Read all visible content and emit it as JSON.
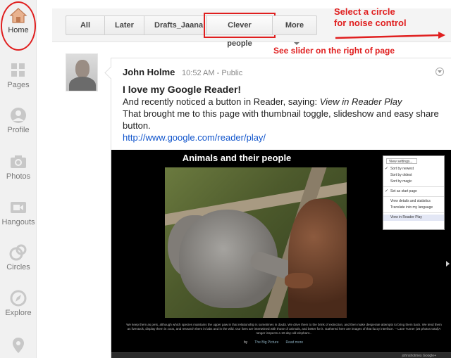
{
  "leftnav": {
    "items": [
      {
        "label": "Home",
        "icon": "home-icon"
      },
      {
        "label": "Pages",
        "icon": "pages-icon"
      },
      {
        "label": "Profile",
        "icon": "profile-icon"
      },
      {
        "label": "Photos",
        "icon": "camera-icon"
      },
      {
        "label": "Hangouts",
        "icon": "video-camera-icon"
      },
      {
        "label": "Circles",
        "icon": "circles-icon"
      },
      {
        "label": "Explore",
        "icon": "compass-icon"
      },
      {
        "label": "",
        "icon": "location-pin-icon"
      }
    ]
  },
  "tabs": [
    {
      "label": "All"
    },
    {
      "label": "Later"
    },
    {
      "label": "Drafts_Jaana"
    },
    {
      "label": "Clever people"
    },
    {
      "label": "More"
    }
  ],
  "annotations": {
    "select_circle": "Select a circle",
    "noise_control": "for noise control",
    "slider_note": "See slider on the right of page"
  },
  "post": {
    "author": "John Holme",
    "time": "10:52 AM",
    "separator": "-",
    "visibility": "Public",
    "title": "I love my Google Reader!",
    "line1_prefix": "And recently noticed a button in Reader, saying: ",
    "line1_italic": "View in Reader Play",
    "line2": "That brought me to this page with thumbnail toggle, slideshow and easy share button.",
    "link": "http://www.google.com/reader/play/"
  },
  "media": {
    "title": "Animals and their people",
    "dropdown": {
      "header": "View settings...",
      "items": [
        {
          "label": "Sort by newest",
          "checked": true
        },
        {
          "label": "Sort by oldest",
          "checked": false
        },
        {
          "label": "Sort by magic",
          "checked": false
        },
        {
          "label": "Set as start page",
          "checked": true
        },
        {
          "label": "View details and statistics",
          "checked": false
        },
        {
          "label": "Translate into my language",
          "checked": false
        },
        {
          "label": "View in Reader Play",
          "checked": false
        }
      ]
    },
    "caption": "We keep them as pets, although which species maintains the upper paw in that relationship is sometimes in doubt. We drive them to the brink of extinction, and then make desperate attempts to bring them back. We tend them as livestock, display them in zoos, and research them in labs and in the wild. Our lives are intertwined with those of animals, and better for it. Gathered here are images of that fuzzy interface. -- Lane Turner (26 photos total)A ranger inspects a 10-day-old elephant...",
    "source_prefix": "by",
    "source_link": "The Big Picture",
    "read_more": "Read more",
    "bar_text": "johnsholmes    Google+"
  }
}
